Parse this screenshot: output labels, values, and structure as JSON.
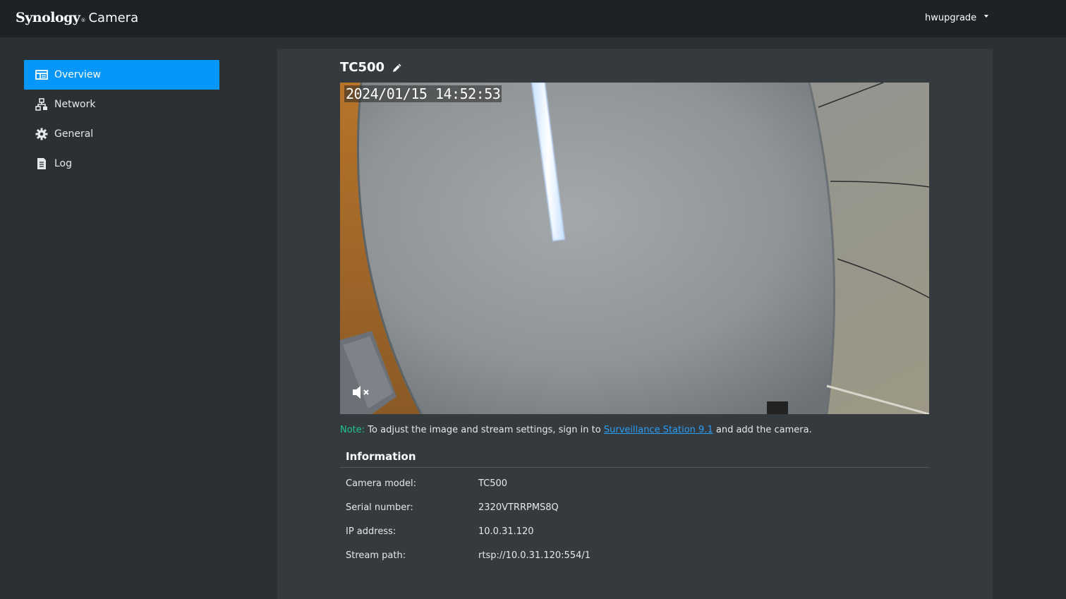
{
  "header": {
    "brand_main": "Synology",
    "brand_mark": "®",
    "brand_product": "Camera",
    "username": "hwupgrade"
  },
  "sidebar": {
    "items": [
      {
        "label": "Overview",
        "icon": "overview-icon",
        "active": true
      },
      {
        "label": "Network",
        "icon": "network-icon",
        "active": false
      },
      {
        "label": "General",
        "icon": "gear-icon",
        "active": false
      },
      {
        "label": "Log",
        "icon": "log-icon",
        "active": false
      }
    ]
  },
  "camera": {
    "name": "TC500",
    "timestamp": "2024/01/15 14:52:53"
  },
  "note": {
    "label": "Note:",
    "text_before": "To adjust the image and stream settings, sign in to",
    "link": "Surveillance Station 9.1",
    "text_after": "and add the camera."
  },
  "information": {
    "title": "Information",
    "rows": [
      {
        "key": "Camera model:",
        "value": "TC500"
      },
      {
        "key": "Serial number:",
        "value": "2320VTRRPMS8Q"
      },
      {
        "key": "IP address:",
        "value": "10.0.31.120"
      },
      {
        "key": "Stream path:",
        "value": "rtsp://10.0.31.120:554/1"
      }
    ]
  },
  "colors": {
    "accent": "#0596fa",
    "note_label": "#22c38e",
    "link": "#2a9df4"
  }
}
